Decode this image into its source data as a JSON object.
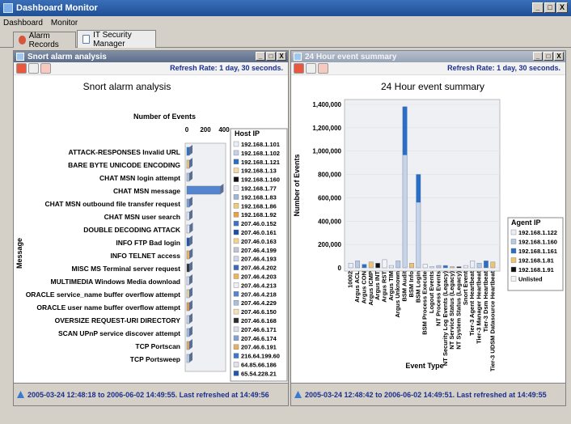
{
  "window": {
    "title": "Dashboard Monitor",
    "min": "_",
    "max": "□",
    "close": "X"
  },
  "menu": {
    "items": [
      "Dashboard",
      "Monitor"
    ]
  },
  "tabs": [
    {
      "label": "Alarm Records"
    },
    {
      "label": "IT Security Manager"
    }
  ],
  "left": {
    "title": "Snort alarm analysis",
    "refresh": "Refresh Rate: 1 day, 30 seconds.",
    "status": "2005-03-24 12:48:18 to 2006-06-02 14:49:55. Last refreshed at 14:49:56",
    "chart_data": {
      "type": "bar",
      "title": "Snort alarm analysis",
      "xlabel": "Number of Events",
      "ylabel": "Message",
      "xlim": [
        0,
        400
      ],
      "ticks": [
        "0",
        "200",
        "400"
      ],
      "categories": [
        "ATTACK-RESPONSES Invalid URL",
        "BARE BYTE UNICODE ENCODING",
        "CHAT MSN login attempt",
        "CHAT MSN message",
        "CHAT MSN outbound file transfer request",
        "CHAT MSN user search",
        "DOUBLE DECODING ATTACK",
        "INFO FTP Bad login",
        "INFO TELNET access",
        "MISC MS Terminal server request",
        "MULTIMEDIA Windows Media download",
        "ORACLE service_name buffer overflow attempt",
        "ORACLE user name buffer overflow attempt",
        "OVERSIZE REQUEST-URI DIRECTORY",
        "SCAN UPnP service discover attempt",
        "TCP Portscan",
        "TCP Portsweep"
      ],
      "values": [
        20,
        25,
        10,
        360,
        8,
        6,
        30,
        22,
        28,
        15,
        12,
        18,
        16,
        14,
        20,
        12,
        10
      ],
      "legend_title": "Host IP",
      "legend": [
        {
          "ip": "192.168.1.101",
          "color": "#e9eef7"
        },
        {
          "ip": "192.168.1.102",
          "color": "#c4d2e8"
        },
        {
          "ip": "192.168.1.121",
          "color": "#2a6fc4"
        },
        {
          "ip": "192.168.1.13",
          "color": "#f3d9a4"
        },
        {
          "ip": "192.168.1.160",
          "color": "#111111"
        },
        {
          "ip": "192.168.1.77",
          "color": "#e3e6ec"
        },
        {
          "ip": "192.168.1.83",
          "color": "#9fb5d8"
        },
        {
          "ip": "192.168.1.86",
          "color": "#f2ca7a"
        },
        {
          "ip": "192.168.1.92",
          "color": "#e8a04a"
        },
        {
          "ip": "207.46.0.152",
          "color": "#3d73c5"
        },
        {
          "ip": "207.46.0.161",
          "color": "#1a4fa8"
        },
        {
          "ip": "207.46.0.163",
          "color": "#f4d48c"
        },
        {
          "ip": "207.46.4.199",
          "color": "#bcc6d8"
        },
        {
          "ip": "207.46.4.193",
          "color": "#cfd7e5"
        },
        {
          "ip": "207.46.4.202",
          "color": "#3b6bb6"
        },
        {
          "ip": "207.46.4.203",
          "color": "#f0b55a"
        },
        {
          "ip": "207.46.4.213",
          "color": "#eef1f6"
        },
        {
          "ip": "207.46.4.218",
          "color": "#5585cf"
        },
        {
          "ip": "207.46.4.229",
          "color": "#a9bfdf"
        },
        {
          "ip": "207.46.6.150",
          "color": "#f7e2b6"
        },
        {
          "ip": "207.46.6.168",
          "color": "#2c2c2c"
        },
        {
          "ip": "207.46.6.171",
          "color": "#d9dee8"
        },
        {
          "ip": "207.46.6.174",
          "color": "#7ea2d6"
        },
        {
          "ip": "207.46.6.191",
          "color": "#e6b063"
        },
        {
          "ip": "216.64.199.60",
          "color": "#3c77cd"
        },
        {
          "ip": "64.85.66.186",
          "color": "#dfe4ec"
        },
        {
          "ip": "65.54.228.21",
          "color": "#1f56b0"
        }
      ]
    }
  },
  "right": {
    "title": "24 Hour event summary",
    "refresh": "Refresh Rate: 1 day, 30 seconds.",
    "status": "2005-03-24 12:48:42 to 2006-06-02 14:49:51. Last refreshed at 14:49:55",
    "chart_data": {
      "type": "bar",
      "title": "24 Hour event summary",
      "xlabel": "Event Type",
      "ylabel": "Number of Events",
      "ylim": [
        0,
        1400000
      ],
      "yticks": [
        "0",
        "200,000",
        "400,000",
        "600,000",
        "800,000",
        "1,000,000",
        "1,200,000",
        "1,400,000"
      ],
      "categories": [
        "10002",
        "Argus ACL",
        "Argus CON",
        "Argus ICMP",
        "Argus INT",
        "Argus RST",
        "Argus TIM",
        "Argus Unknown",
        "BSM Audit",
        "BSM Info",
        "BSM Login",
        "BSM Process Execute",
        "Logout Events",
        "NT Process Events",
        "NT Security Log Events (Legacy)",
        "NT Service Status (Legacy)",
        "NT System Status (Legacy)",
        "Snort Event",
        "Tier-3 Agent Heartbeat",
        "Tier-3 Manager Heartbeat",
        "Tier-3 Dsm Heartbeat",
        "Tier-3 UDSM Datasource Heartbeat"
      ],
      "values": [
        40000,
        60000,
        30000,
        50000,
        40000,
        70000,
        20000,
        60000,
        1380000,
        40000,
        800000,
        30000,
        10000,
        20000,
        20000,
        10000,
        10000,
        20000,
        60000,
        40000,
        60000,
        50000
      ],
      "legend_title": "Agent IP",
      "legend": [
        {
          "ip": "192.168.1.122",
          "color": "#e9eef7"
        },
        {
          "ip": "192.168.1.160",
          "color": "#b9c9e4"
        },
        {
          "ip": "192.168.1.161",
          "color": "#2a6fc4"
        },
        {
          "ip": "192.168.1.81",
          "color": "#f0c36c"
        },
        {
          "ip": "192.168.1.91",
          "color": "#111111"
        },
        {
          "ip": "Unlisted",
          "color": "#f4f4f4"
        }
      ]
    }
  }
}
